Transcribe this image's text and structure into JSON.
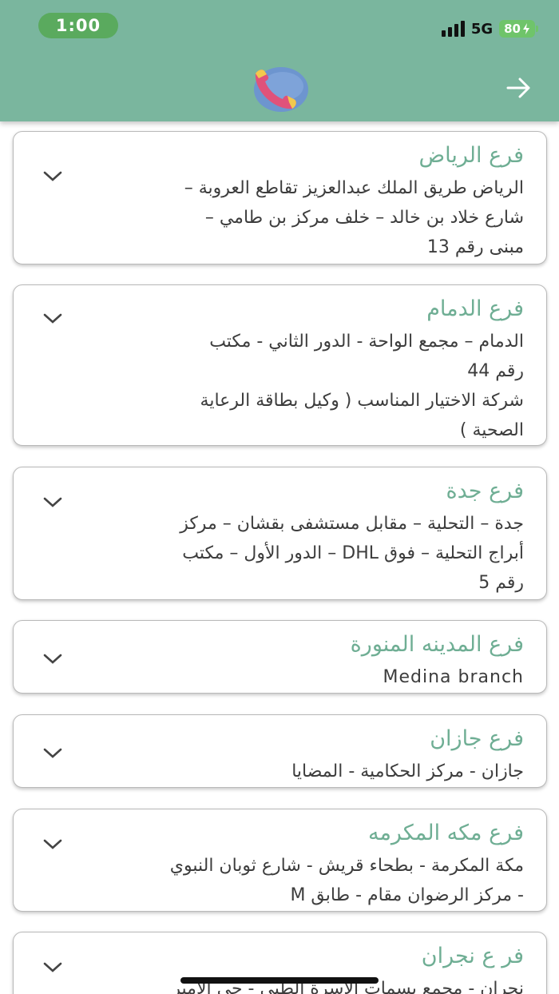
{
  "status_bar": {
    "time": "1:00",
    "network": "5G",
    "battery": "80"
  },
  "header": {
    "logo_icon": "phone-globe-icon",
    "back_icon": "arrow-right-icon"
  },
  "branches": [
    {
      "title": "فرع الرياض",
      "lines": [
        "الرياض طريق الملك عبدالعزيز تقاطع العروبة –",
        "شارع خلاد بن خالد – خلف مركز بن طامي –",
        "مبنى رقم 13"
      ]
    },
    {
      "title": "فرع الدمام",
      "lines": [
        "الدمام – مجمع الواحة - الدور الثاني - مكتب",
        "رقم 44",
        "شركة الاختيار المناسب ( وكيل بطاقة الرعاية",
        "الصحية )"
      ]
    },
    {
      "title": "فرع جدة",
      "lines": [
        "جدة – التحلية –  مقابل مستشفى بقشان – مركز",
        "أبراج التحلية – فوق DHL – الدور الأول – مكتب",
        "رقم 5"
      ]
    },
    {
      "title": "فرع المدينه المنورة",
      "lines": [
        "Medina branch"
      ]
    },
    {
      "title": "فرع جازان",
      "lines": [
        "جازان - مركز الحكامية - المضايا"
      ]
    },
    {
      "title": "فرع مكه المكرمه",
      "lines": [
        "مكة المكرمة - بطحاء قريش - شارع ثوبان النبوي",
        "- مركز الرضوان مقام - طابق M"
      ]
    },
    {
      "title": "فر ع نجران",
      "lines": [
        "نجران - مجمع بسمات الاسرة الطبي - حي الامير"
      ]
    }
  ]
}
